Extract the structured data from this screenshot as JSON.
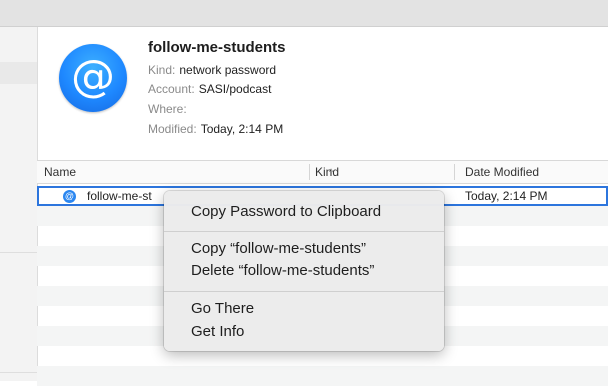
{
  "item": {
    "title": "follow-me-students",
    "icon": "at-sign-icon",
    "kind_label": "Kind:",
    "kind_value": "network password",
    "account_label": "Account:",
    "account_value": "SASI/podcast",
    "where_label": "Where:",
    "where_value": "",
    "modified_label": "Modified:",
    "modified_value": "Today, 2:14 PM"
  },
  "table": {
    "columns": [
      "Name",
      "Kind",
      "Date Modified"
    ],
    "sort_indicator": "^",
    "rows": [
      {
        "name": "follow-me-st",
        "kind": "",
        "date": "Today, 2:14 PM",
        "icon": "at-sign-icon"
      }
    ]
  },
  "context_menu": {
    "items": [
      "Copy Password to Clipboard",
      "Copy “follow-me-students”",
      "Delete “follow-me-students”",
      "Go There",
      "Get Info"
    ]
  },
  "colors": {
    "selection_outline": "#2c75dd",
    "icon_blue": "#1e88ff"
  }
}
